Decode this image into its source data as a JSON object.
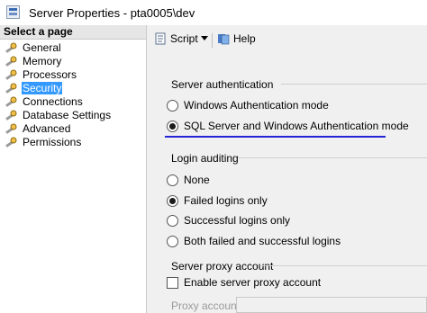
{
  "window": {
    "title": "Server Properties - pta0005\\dev"
  },
  "left_pane": {
    "header": "Select a page",
    "items": [
      {
        "label": "General",
        "selected": false
      },
      {
        "label": "Memory",
        "selected": false
      },
      {
        "label": "Processors",
        "selected": false
      },
      {
        "label": "Security",
        "selected": true
      },
      {
        "label": "Connections",
        "selected": false
      },
      {
        "label": "Database Settings",
        "selected": false
      },
      {
        "label": "Advanced",
        "selected": false
      },
      {
        "label": "Permissions",
        "selected": false
      }
    ]
  },
  "toolbar": {
    "script_label": "Script",
    "help_label": "Help"
  },
  "server_auth": {
    "title": "Server authentication",
    "options": [
      {
        "label": "Windows Authentication mode",
        "checked": false
      },
      {
        "label": "SQL Server and Windows Authentication mode",
        "checked": true
      }
    ]
  },
  "login_auditing": {
    "title": "Login auditing",
    "options": [
      {
        "label": "None",
        "checked": false
      },
      {
        "label": "Failed logins only",
        "checked": true
      },
      {
        "label": "Successful logins only",
        "checked": false
      },
      {
        "label": "Both failed and successful logins",
        "checked": false
      }
    ]
  },
  "proxy": {
    "title": "Server proxy account",
    "enable_label": "Enable server proxy account",
    "enable_checked": false,
    "account_label": "Proxy account:",
    "account_value": ""
  },
  "colors": {
    "selection": "#3399ff",
    "annotation": "#2525d8",
    "panel": "#f0f0f0"
  }
}
